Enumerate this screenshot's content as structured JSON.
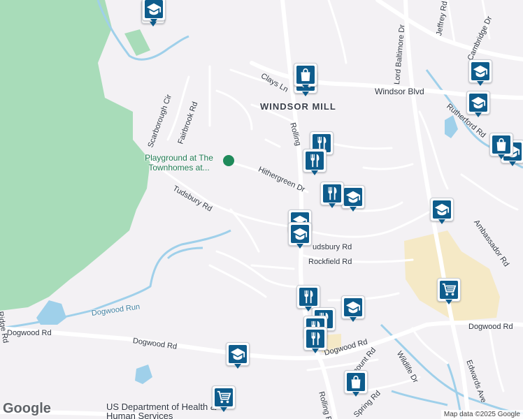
{
  "map": {
    "area_label": "WINDSOR MILL",
    "park_label": "Playground at The Townhomes at...",
    "water_label": "Dogwood Run",
    "roads": [
      {
        "id": "clays",
        "name": "Clays Ln"
      },
      {
        "id": "windsor",
        "name": "Windsor Blvd"
      },
      {
        "id": "rolling1",
        "name": "Rolling"
      },
      {
        "id": "rolling2",
        "name": "Rolling R"
      },
      {
        "id": "hithergreen",
        "name": "Hithergreen Dr"
      },
      {
        "id": "tudsbury1",
        "name": "Tudsbury Rd"
      },
      {
        "id": "tudsbury2",
        "name": "udsbury Rd"
      },
      {
        "id": "rockfield",
        "name": "Rockfield Rd"
      },
      {
        "id": "dogwood1",
        "name": "Dogwood Rd"
      },
      {
        "id": "dogwood2",
        "name": "Dogwood Rd"
      },
      {
        "id": "dogwood3",
        "name": "Dogwood Rd"
      },
      {
        "id": "dogwood4",
        "name": "Dogwood Rd"
      },
      {
        "id": "fairbrook",
        "name": "Fairbrook Rd"
      },
      {
        "id": "scarborough",
        "name": "Scarborough Cir"
      },
      {
        "id": "lordbalt",
        "name": "Lord Baltimore Dr"
      },
      {
        "id": "jeffrey",
        "name": "Jeffrey Rd"
      },
      {
        "id": "cambridge",
        "name": "Cambridge Dr"
      },
      {
        "id": "rutherford",
        "name": "Rutherford Rd"
      },
      {
        "id": "ambassador",
        "name": "Ambassador Rd"
      },
      {
        "id": "edwards",
        "name": "Edwards Ave"
      },
      {
        "id": "wildlife",
        "name": "Wildlife Dr"
      },
      {
        "id": "mount",
        "name": "mount Rd"
      },
      {
        "id": "spring",
        "name": "Spring Rd"
      },
      {
        "id": "ridge",
        "name": "Ridge Rd"
      }
    ],
    "poi_label": "US Department of Health & Human Services",
    "pins": [
      {
        "type": "school"
      },
      {
        "type": "school"
      },
      {
        "type": "school"
      },
      {
        "type": "school"
      },
      {
        "type": "school"
      },
      {
        "type": "school"
      },
      {
        "type": "school"
      },
      {
        "type": "school"
      },
      {
        "type": "school"
      },
      {
        "type": "school"
      },
      {
        "type": "school"
      },
      {
        "type": "grocery"
      },
      {
        "type": "grocery"
      },
      {
        "type": "grocery"
      },
      {
        "type": "shopping"
      },
      {
        "type": "shopping"
      },
      {
        "type": "shopping"
      },
      {
        "type": "restaurant"
      },
      {
        "type": "restaurant"
      },
      {
        "type": "restaurant"
      },
      {
        "type": "restaurant"
      },
      {
        "type": "restaurant"
      },
      {
        "type": "restaurant"
      },
      {
        "type": "restaurant"
      }
    ],
    "logo": "Google",
    "attribution": "Map data ©2025 Google",
    "colors": {
      "background": "#f3f1f4",
      "park": "#a6d8b8",
      "water": "#9fd0ea",
      "road": "#ffffff",
      "sand": "#f4e7c3",
      "pin": "#0e5c8c"
    }
  }
}
